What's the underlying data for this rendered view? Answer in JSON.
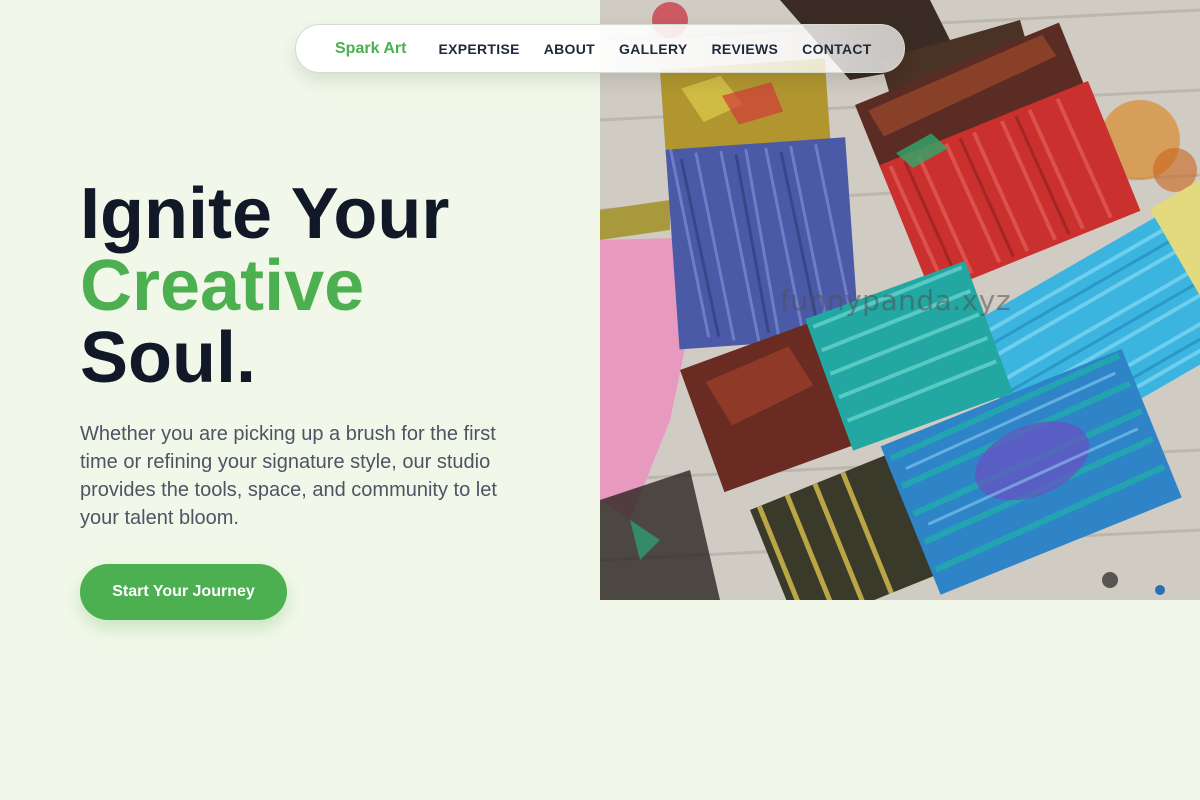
{
  "nav": {
    "brand": "Spark Art",
    "links": [
      "EXPERTISE",
      "ABOUT",
      "GALLERY",
      "REVIEWS",
      "CONTACT"
    ]
  },
  "hero": {
    "headline": {
      "line1": "Ignite Your",
      "line2": "Creative",
      "line3": "Soul."
    },
    "subtext": "Whether you are picking up a brush for the first time or refining your signature style, our studio provides the tools, space, and community to let your talent bloom.",
    "cta_label": "Start Your Journey",
    "image_watermark": "funnypanda.xyz"
  },
  "colors": {
    "page_background": "#f1f8e9",
    "accent_green": "#4caf50",
    "headline_dark": "#111827",
    "body_text": "#4b5563"
  },
  "icons": {
    "hero_image": "paintbrushes-photo"
  }
}
